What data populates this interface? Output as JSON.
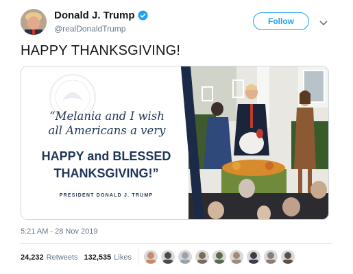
{
  "author": {
    "name": "Donald J. Trump",
    "handle": "@realDonaldTrump",
    "verified_icon": "verified-badge-icon",
    "avatar_icon": "avatar"
  },
  "actions": {
    "follow_label": "Follow",
    "more_icon": "chevron-down-icon"
  },
  "tweet": {
    "text": "HAPPY THANKSGIVING!",
    "timestamp": "5:21 AM - 28 Nov 2019"
  },
  "media_card": {
    "quote_line1": "“Melania and I wish",
    "quote_line2": "all Americans a very",
    "bold_line1": "HAPPY and BLESSED",
    "bold_line2": "THANKSGIVING!”",
    "attribution": "PRESIDENT DONALD J. TRUMP"
  },
  "engagement": {
    "retweets_count": "24,232",
    "retweets_label": "Retweets",
    "likes_count": "132,535",
    "likes_label": "Likes",
    "liker_avatar_colors": [
      "#c98a6a",
      "#4a4a4a",
      "#9aa3ab",
      "#7a6a5a",
      "#5c6b4e",
      "#a08a7a",
      "#3d3d4a",
      "#8a7f78",
      "#5a5048"
    ]
  },
  "colors": {
    "accent": "#1da1f2",
    "navy": "#1f3558"
  }
}
